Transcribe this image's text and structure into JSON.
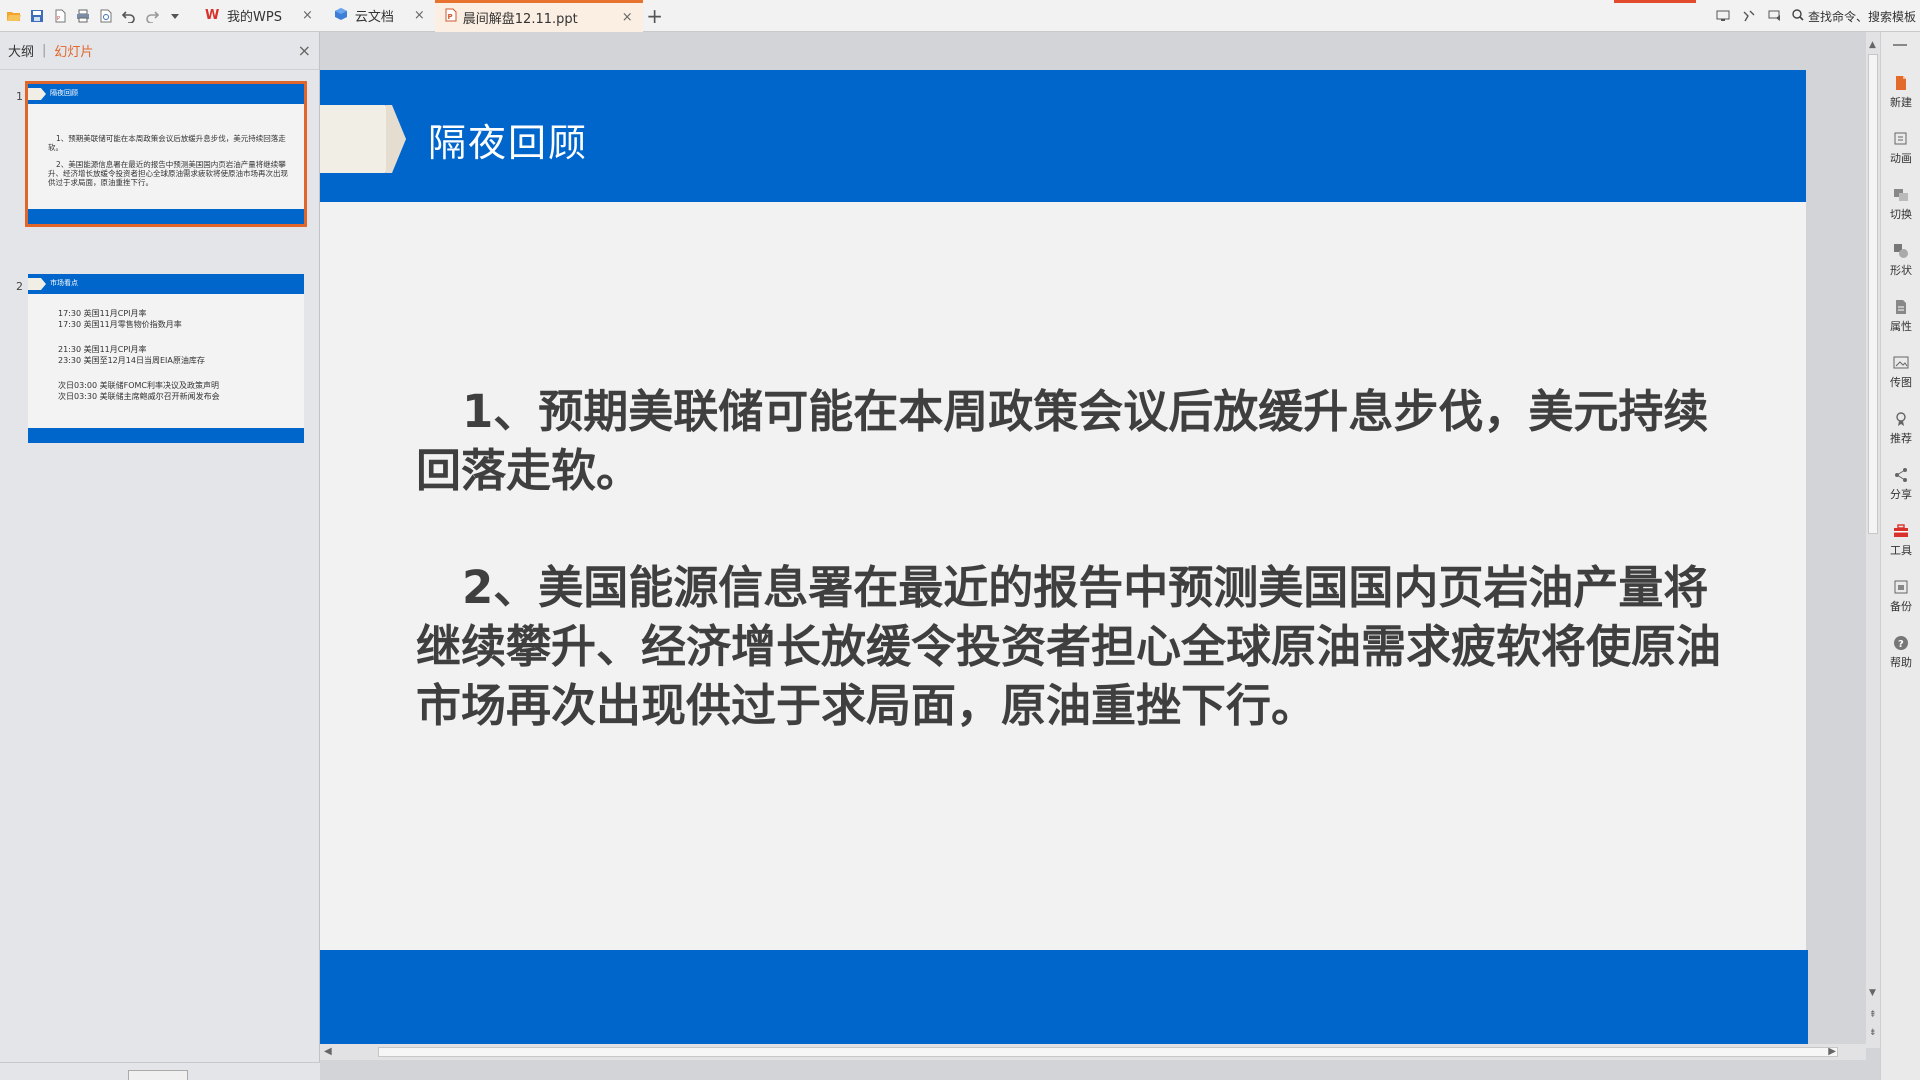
{
  "tabs": [
    {
      "label": "我的WPS",
      "icon": "wps-logo-icon"
    },
    {
      "label": "云文档",
      "icon": "cloud-doc-icon"
    },
    {
      "label": "晨间解盘12.11.ppt",
      "icon": "ppt-file-icon",
      "active": true
    }
  ],
  "topbar": {
    "search_label": "查找命令、搜索模板"
  },
  "left_panel": {
    "tab_outline": "大纲",
    "tab_slides": "幻灯片",
    "active_tab": "幻灯片"
  },
  "thumbnails": [
    {
      "number": "1",
      "title": "隔夜回顾",
      "paragraphs": [
        "1、预期美联储可能在本周政策会议后放缓升息步伐，美元持续回落走软。",
        "2、美国能源信息署在最近的报告中预测美国国内页岩油产量将继续攀升、经济增长放缓令投资者担心全球原油需求疲软将使原油市场再次出现供过于求局面，原油重挫下行。"
      ]
    },
    {
      "number": "2",
      "title": "市场看点",
      "lines": [
        [
          "17:30 英国11月CPI月率",
          "17:30 英国11月零售物价指数月率"
        ],
        [
          "21:30 美国11月CPI月率",
          "23:30 美国至12月14日当周EIA原油库存"
        ],
        [
          "次日03:00 美联储FOMC利率决议及政策声明",
          "次日03:30 美联储主席鲍威尔召开新闻发布会"
        ]
      ]
    }
  ],
  "slide": {
    "title": "隔夜回顾",
    "paragraphs": [
      "1、预期美联储可能在本周政策会议后放缓升息步伐，美元持续回落走软。",
      "2、美国能源信息署在最近的报告中预测美国国内页岩油产量将继续攀升、经济增长放缓令投资者担心全球原油需求疲软将使原油市场再次出现供过于求局面，原油重挫下行。"
    ]
  },
  "right_sidebar": [
    {
      "label": "新建",
      "icon": "new-icon"
    },
    {
      "label": "动画",
      "icon": "animation-icon"
    },
    {
      "label": "切换",
      "icon": "transition-icon"
    },
    {
      "label": "形状",
      "icon": "shape-icon"
    },
    {
      "label": "属性",
      "icon": "property-icon"
    },
    {
      "label": "传图",
      "icon": "upload-image-icon"
    },
    {
      "label": "推荐",
      "icon": "recommend-icon"
    },
    {
      "label": "分享",
      "icon": "share-icon"
    },
    {
      "label": "工具",
      "icon": "toolbox-icon"
    },
    {
      "label": "备份",
      "icon": "backup-icon"
    },
    {
      "label": "帮助",
      "icon": "help-icon"
    }
  ],
  "colors": {
    "accent": "#e0662c",
    "slide_blue": "#0066cc",
    "slide_bg": "#f2f2f2",
    "body_text": "#3f3f3f"
  }
}
